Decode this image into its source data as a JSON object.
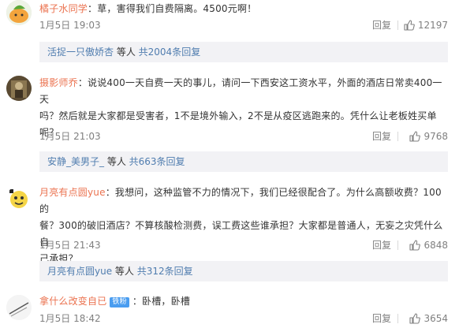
{
  "comments": [
    {
      "user": "橘子水同学",
      "content": "：草，害得我们自费隔离。4500元啊！",
      "time": "1月5日 19:03",
      "reply_label": "回复",
      "likes": "12197",
      "sub": {
        "users": "活捉一只傲娇杏",
        "middle": " 等人 ",
        "count": "共2004条回复"
      }
    },
    {
      "user": "摄影师乔",
      "content_1": "：说说400一天自费一天的事儿，请问一下西安这工资水平，外面的酒店日常卖400一天",
      "content_2": "吗？然后就是大家都是受害者，1不是境外输入，2不是从疫区逃跑来的。凭什么让老板姓买单",
      "content_3": "呢？",
      "time": "1月5日 21:03",
      "reply_label": "回复",
      "likes": "9768",
      "sub": {
        "users": "安静_美男子_",
        "middle": " 等人 ",
        "count": "共663条回复"
      }
    },
    {
      "user": "月亮有点圆yue",
      "content_1": "：我想问，这种监管不力的情况下，我们已经很配合了。为什么高额收费？100的",
      "content_2": "餐？300的破旧酒店？不算核酸检测费，误工费这些谁承担？大家都是普通人，无妄之灾凭什么自",
      "content_3": "己承担？",
      "time": "1月5日 21:43",
      "reply_label": "回复",
      "likes": "6848",
      "sub": {
        "users": "月亮有点圆yue",
        "middle": " 等人 ",
        "count": "共312条回复"
      }
    },
    {
      "user": "拿什么改变自已",
      "badge": "铁粉",
      "content": "：卧槽，卧槽",
      "time": "1月5日 18:42",
      "reply_label": "回复",
      "likes": "3654"
    }
  ],
  "colors": {
    "username": "#eb7350",
    "link": "#507daf",
    "meta": "#808080",
    "subbox_bg": "#f2f2f5",
    "badge_bg": "#4a9df0"
  },
  "icons": {
    "like": "thumbs-up-icon"
  }
}
